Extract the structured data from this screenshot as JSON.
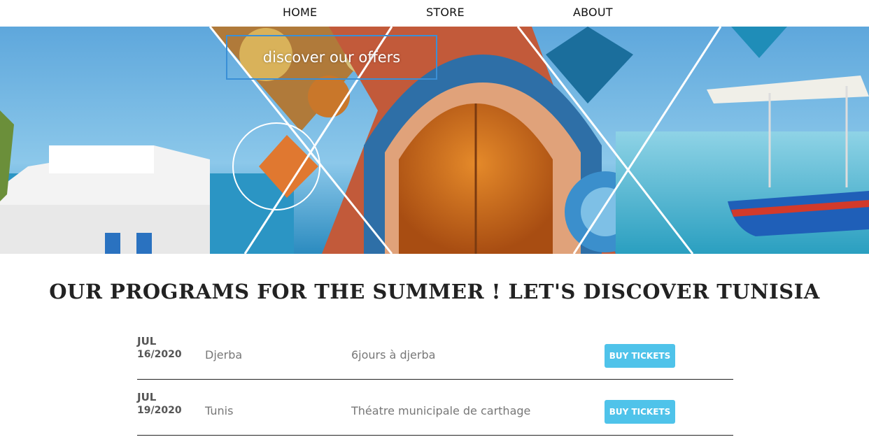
{
  "nav": {
    "items": [
      {
        "label": "HOME"
      },
      {
        "label": "STORE"
      },
      {
        "label": "ABOUT"
      }
    ]
  },
  "hero": {
    "cta_label": "discover our offers"
  },
  "programs": {
    "title": "OUR PROGRAMS FOR THE SUMMER ! LET'S DISCOVER TUNISIA",
    "events": [
      {
        "month": "JUL",
        "day": "16/2020",
        "city": "Djerba",
        "description": "6jours à djerba",
        "button_label": "BUY TICKETS"
      },
      {
        "month": "JUL",
        "day": "19/2020",
        "city": "Tunis",
        "description": "Théatre municipale de carthage",
        "button_label": "BUY TICKETS"
      }
    ]
  },
  "colors": {
    "accent": "#4fc3ea",
    "cta_border": "#3a8fd6",
    "divider": "#222222"
  }
}
